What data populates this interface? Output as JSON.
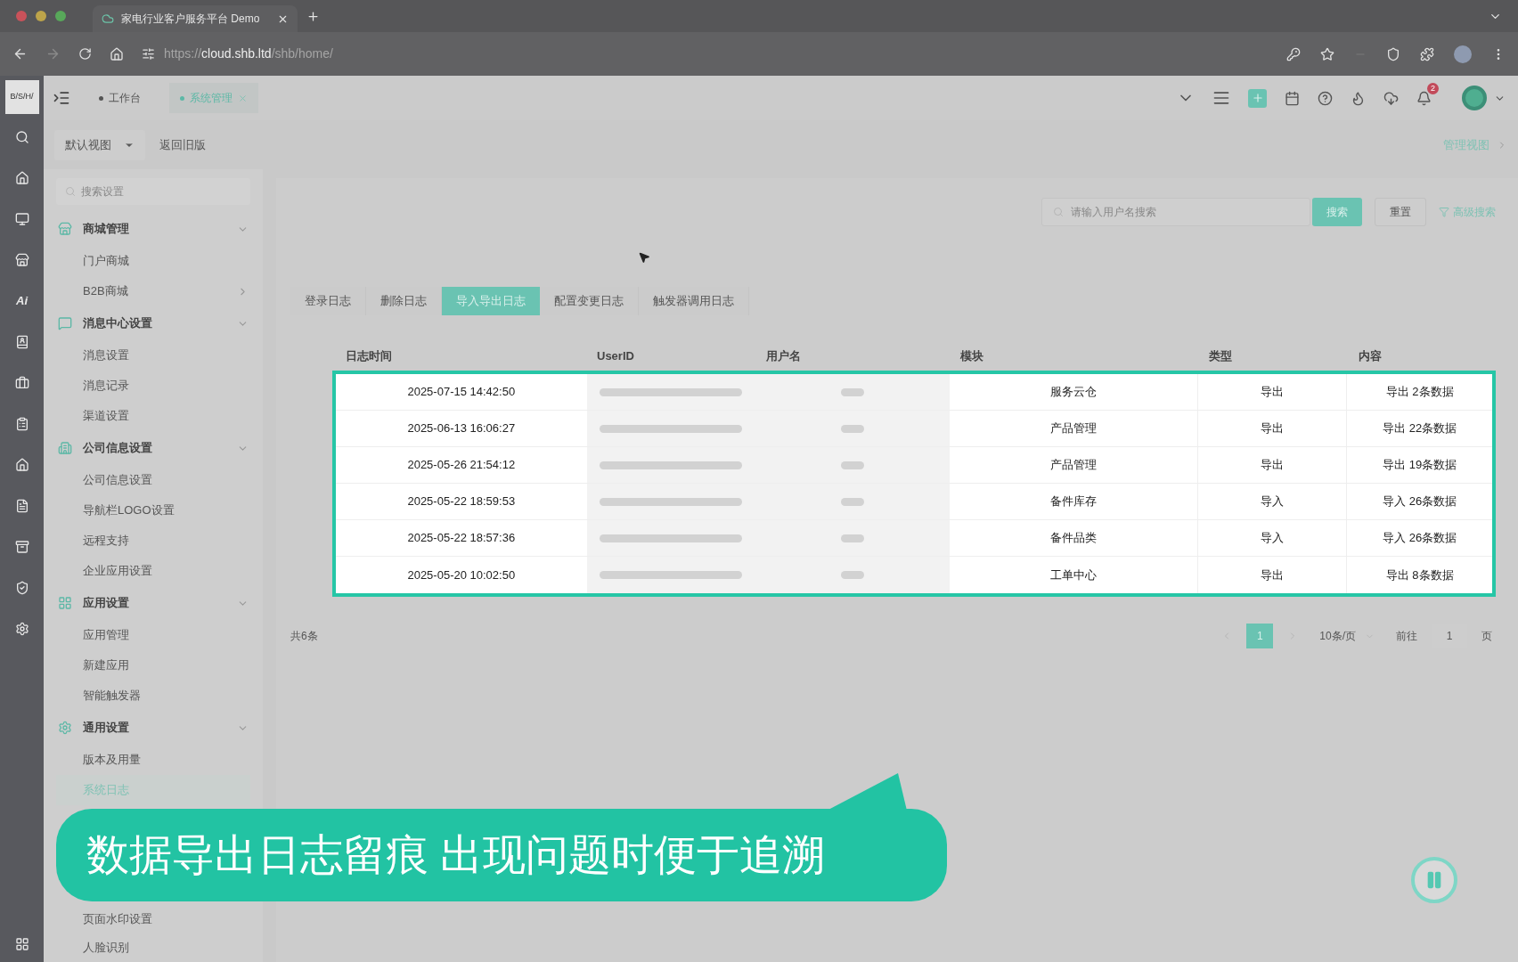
{
  "browser": {
    "tab_title": "家电行业客户服务平台 Demo",
    "url": {
      "scheme": "https://",
      "host": "cloud.shb.ltd",
      "path": "/shb/home/"
    }
  },
  "app": {
    "logo": "B/S/H/",
    "rail_label": "Ai",
    "notification_count": "2"
  },
  "page_tabs": [
    {
      "label": "工作台",
      "selected": false
    },
    {
      "label": "系统管理",
      "selected": true
    }
  ],
  "view_select": "默认视图",
  "back_link": "返回旧版",
  "manage_view_link": "管理视图",
  "settings_search": {
    "placeholder": "搜索设置"
  },
  "menu": [
    {
      "title": "商城管理",
      "expanded": true,
      "items": [
        {
          "label": "门户商城",
          "selected": false,
          "submenu": false
        },
        {
          "label": "B2B商城",
          "selected": false,
          "submenu": true
        }
      ]
    },
    {
      "title": "消息中心设置",
      "expanded": true,
      "items": [
        {
          "label": "消息设置",
          "selected": false,
          "submenu": false
        },
        {
          "label": "消息记录",
          "selected": false,
          "submenu": false
        },
        {
          "label": "渠道设置",
          "selected": false,
          "submenu": false
        }
      ]
    },
    {
      "title": "公司信息设置",
      "expanded": true,
      "items": [
        {
          "label": "公司信息设置",
          "selected": false,
          "submenu": false
        },
        {
          "label": "导航栏LOGO设置",
          "selected": false,
          "submenu": false
        },
        {
          "label": "远程支持",
          "selected": false,
          "submenu": false
        },
        {
          "label": "企业应用设置",
          "selected": false,
          "submenu": false
        }
      ]
    },
    {
      "title": "应用设置",
      "expanded": true,
      "items": [
        {
          "label": "应用管理",
          "selected": false,
          "submenu": false
        },
        {
          "label": "新建应用",
          "selected": false,
          "submenu": false
        },
        {
          "label": "智能触发器",
          "selected": false,
          "submenu": false
        }
      ]
    },
    {
      "title": "通用设置",
      "expanded": true,
      "items": [
        {
          "label": "版本及用量",
          "selected": false,
          "submenu": false
        },
        {
          "label": "系统日志",
          "selected": true,
          "submenu": false
        }
      ]
    }
  ],
  "menu_items_below_caption": [
    "页面水印设置",
    "人脸识别"
  ],
  "search": {
    "placeholder": "请输入用户名搜索",
    "search_button": "搜索",
    "reset_button": "重置",
    "advanced_link": "高级搜索"
  },
  "log_tabs": [
    {
      "label": "登录日志",
      "selected": false
    },
    {
      "label": "删除日志",
      "selected": false
    },
    {
      "label": "导入导出日志",
      "selected": true
    },
    {
      "label": "配置变更日志",
      "selected": false
    },
    {
      "label": "触发器调用日志",
      "selected": false
    }
  ],
  "table": {
    "columns": [
      "日志时间",
      "UserID",
      "用户名",
      "模块",
      "类型",
      "内容"
    ],
    "rows": [
      {
        "time": "2025-07-15 14:42:50",
        "module": "服务云仓",
        "type": "导出",
        "content": "导出 2条数据"
      },
      {
        "time": "2025-06-13 16:06:27",
        "module": "产品管理",
        "type": "导出",
        "content": "导出 22条数据"
      },
      {
        "time": "2025-05-26 21:54:12",
        "module": "产品管理",
        "type": "导出",
        "content": "导出 19条数据"
      },
      {
        "time": "2025-05-22 18:59:53",
        "module": "备件库存",
        "type": "导入",
        "content": "导入 26条数据"
      },
      {
        "time": "2025-05-22 18:57:36",
        "module": "备件品类",
        "type": "导入",
        "content": "导入 26条数据"
      },
      {
        "time": "2025-05-20 10:02:50",
        "module": "工单中心",
        "type": "导出",
        "content": "导出 8条数据"
      }
    ]
  },
  "pagination": {
    "total": "共6条",
    "pages": [
      {
        "label": "1",
        "selected": true
      }
    ],
    "page_size": "10条/页",
    "goto_label": "前往",
    "goto_value": "1",
    "goto_suffix": "页"
  },
  "caption": "数据导出日志留痕 出现问题时便于追溯"
}
